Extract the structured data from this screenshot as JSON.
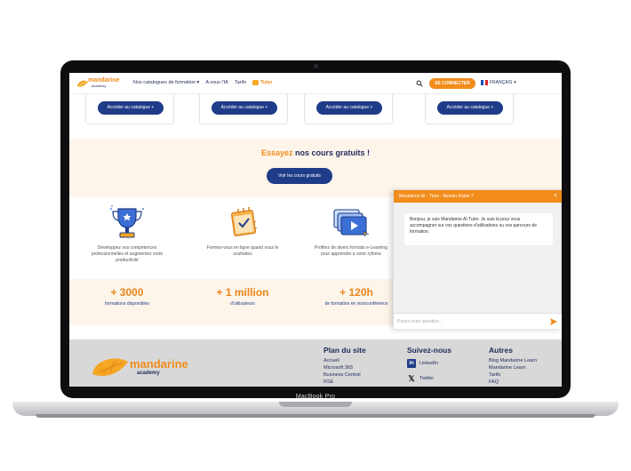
{
  "device": {
    "label": "MacBook Pro"
  },
  "header": {
    "logo": {
      "name": "mandarine",
      "sub": "academy"
    },
    "nav": [
      {
        "label": "Nos catalogues de formation",
        "dropdown": true
      },
      {
        "label": "A vous l'IA"
      },
      {
        "label": "Tarifs"
      }
    ],
    "tutor_label": "Tutor",
    "connect_label": "SE CONNECTER",
    "language": "FRANÇAIS"
  },
  "catalog_buttons": [
    "Accéder au catalogue +",
    "Accéder au catalogue +",
    "Accéder au catalogue +",
    "Accéder au catalogue +"
  ],
  "promo": {
    "title_accent": "Essayez",
    "title_rest": " nos cours gratuits !",
    "button": "Voir les cours gratuits"
  },
  "features": [
    {
      "icon": "trophy-icon",
      "text": "Développez vos compétences professionnelles et augmentez votre productivité"
    },
    {
      "icon": "calendar-icon",
      "text": "Formez-vous en ligne quand vous le souhaitez"
    },
    {
      "icon": "video-formats-icon",
      "text": "Profitez de divers formats e-Learning pour apprendre à votre rythme"
    }
  ],
  "stats": [
    {
      "number": "+ 3000",
      "label": "formations disponibles"
    },
    {
      "number": "+ 1 million",
      "label": "d'utilisateurs"
    },
    {
      "number": "+ 120h",
      "label": "de formation en visioconférence"
    }
  ],
  "footer": {
    "logo": {
      "name": "mandarine",
      "sub": "academy"
    },
    "plan": {
      "title": "Plan du site",
      "links": [
        "Accueil",
        "Microsoft 365",
        "Business Central",
        "RSE"
      ]
    },
    "follow": {
      "title": "Suivez-nous",
      "links": [
        "LinkedIn",
        "Twitter"
      ]
    },
    "others": {
      "title": "Autres",
      "links": [
        "Blog Mandarine Learn",
        "Mandarine Learn",
        "Tarifs",
        "FAQ"
      ]
    }
  },
  "chat": {
    "title": "Mandarine AI - Tutor - Besoin d'aide ?",
    "close": "×",
    "message": "Bonjour, je suis Mandarine AI Tutor. Je suis là pour vous accompagner sur vos questions d'utilisations ou vos parcours de formation.",
    "placeholder": "Posez votre question..."
  },
  "colors": {
    "accent": "#f28c1a",
    "primary": "#1f3c88",
    "cream": "#fdf4ea",
    "footer": "#d8d8d8"
  }
}
